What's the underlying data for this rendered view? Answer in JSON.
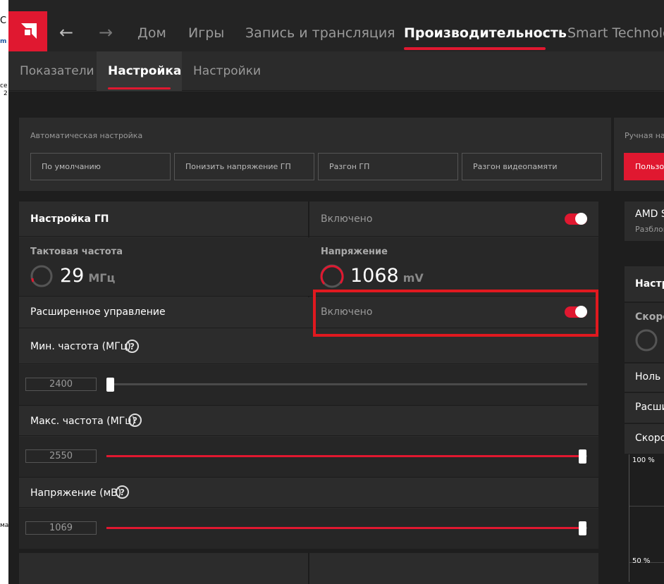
{
  "left_strip": {
    "fragments": [
      "C",
      "m",
      "ce",
      "2",
      "ма"
    ]
  },
  "nav": {
    "back_icon": "arrow-left-icon",
    "forward_icon": "arrow-right-icon",
    "items": [
      "Дом",
      "Игры",
      "Запись и трансляция",
      "Производительность",
      "Smart Technolo"
    ]
  },
  "subnav": {
    "tabs": [
      "Показатели",
      "Настройка",
      "Настройки"
    ]
  },
  "auto_tuning": {
    "label": "Автоматическая настройка",
    "presets": [
      "По умолчанию",
      "Понизить напряжение ГП",
      "Разгон ГП",
      "Разгон видеопамяти"
    ]
  },
  "manual_tuning": {
    "label": "Ручная нас",
    "button": "Пользов"
  },
  "gpu_tuning": {
    "title": "Настройка ГП",
    "state": "Включено",
    "clock_label": "Тактовая частота",
    "clock_value": "29",
    "clock_unit": "МГц",
    "voltage_label": "Напряжение",
    "voltage_value": "1068",
    "voltage_unit": "mV",
    "advanced_label": "Расширенное управление",
    "advanced_state": "Включено",
    "min_freq_label": "Мин. частота (МГц)",
    "min_freq_value": "2400",
    "max_freq_label": "Макс. частота (МГц)",
    "max_freq_value": "2550",
    "volt_mv_label": "Напряжение (мВ)",
    "volt_mv_value": "1069",
    "help_glyph": "?"
  },
  "right_panels": {
    "amd_title": "AMD S",
    "amd_sub": "Разблок",
    "tuning_title": "Настр",
    "speed_label": "Скоро",
    "zero_label": "Ноль с",
    "ext_label": "Расши",
    "speed2_label": "Скоро",
    "chart_top": "100 %",
    "chart_mid": "50 %"
  },
  "colors": {
    "accent": "#e01830",
    "highlight": "#e0191f"
  }
}
